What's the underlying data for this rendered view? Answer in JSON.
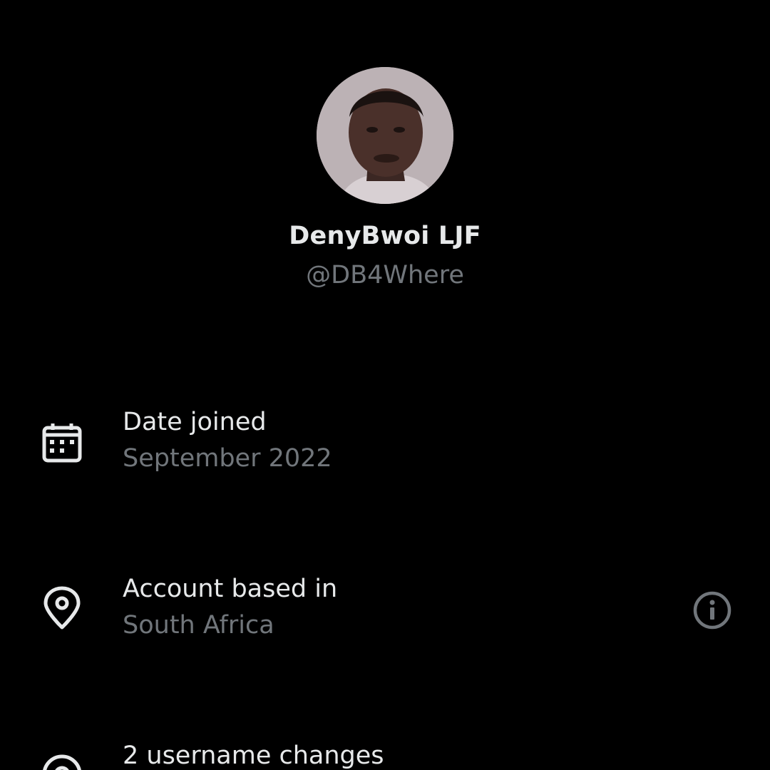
{
  "profile": {
    "display_name": "DenyBwoi LJF",
    "handle": "@DB4Where",
    "avatar_icon": "profile-photo"
  },
  "rows": [
    {
      "icon": "calendar-icon",
      "title": "Date joined",
      "value": "September 2022"
    },
    {
      "icon": "location-pin-icon",
      "title": "Account based in",
      "value": "South Africa",
      "action_icon": "info-icon"
    },
    {
      "icon": "username-change-icon",
      "title": "2 username changes"
    }
  ],
  "colors": {
    "background": "#000000",
    "primary_text": "#e7e9ea",
    "secondary_text": "#71767b"
  }
}
